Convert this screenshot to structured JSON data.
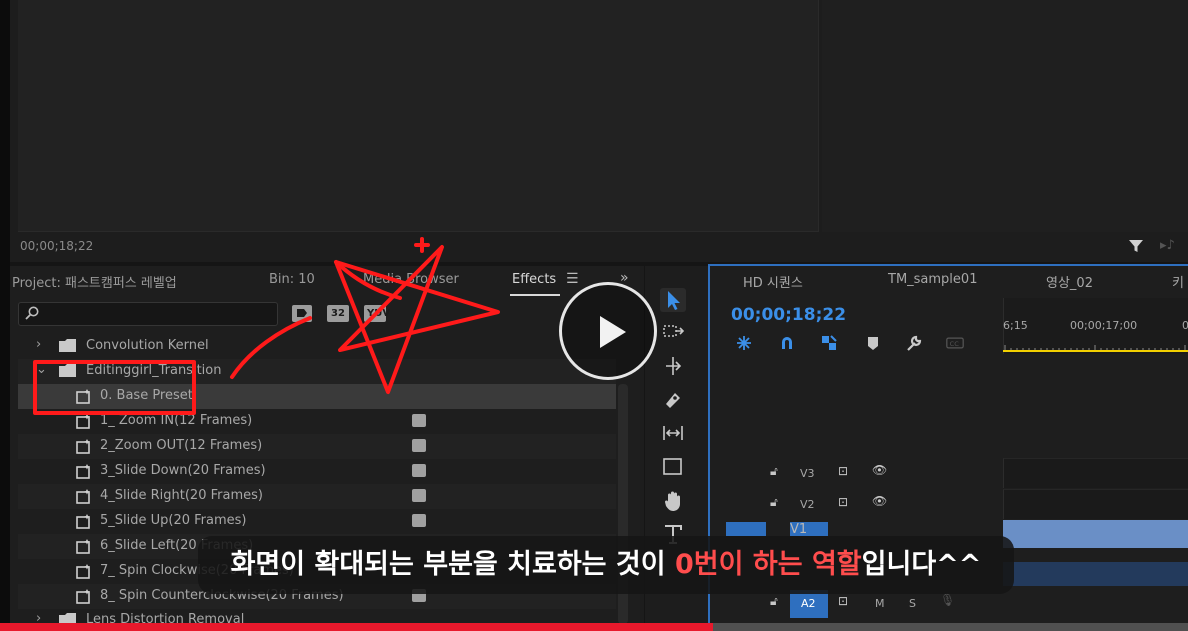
{
  "program_monitor": {
    "timecode": "00;00;18;22"
  },
  "effects_panel": {
    "tabs": [
      {
        "label": "Project: 패스트캠퍼스 레벨업",
        "active": false
      },
      {
        "label": "Bin: 10",
        "active": false
      },
      {
        "label": "Media Browser",
        "active": false
      },
      {
        "label": "Effects",
        "active": true
      }
    ],
    "menu_icon": "hamburger-icon",
    "overflow_icon": "double-chevron-right-icon",
    "search": {
      "value": "",
      "placeholder": "",
      "icon": "search-icon"
    },
    "filter_buttons": [
      "accelerated-icon",
      "32",
      "YUV"
    ],
    "tree": [
      {
        "label": "Convolution Kernel",
        "type": "folder",
        "expanded": false
      },
      {
        "label": "Editinggirl_Transition",
        "type": "folder",
        "expanded": true
      },
      {
        "label": "0. Base Preset",
        "type": "preset",
        "selected": true
      },
      {
        "label": "1_ Zoom IN(12 Frames)",
        "type": "preset"
      },
      {
        "label": "2_Zoom OUT(12 Frames)",
        "type": "preset"
      },
      {
        "label": "3_Slide Down(20 Frames)",
        "type": "preset"
      },
      {
        "label": "4_Slide Right(20 Frames)",
        "type": "preset"
      },
      {
        "label": "5_Slide Up(20 Frames)",
        "type": "preset"
      },
      {
        "label": "6_Slide Left(20 Frames)",
        "type": "preset"
      },
      {
        "label": "7_ Spin Clockwise(20 Frames)",
        "type": "preset"
      },
      {
        "label": "8_ Spin Counterclockwise(20 Frames)",
        "type": "preset"
      },
      {
        "label": "Lens Distortion Removal",
        "type": "folder",
        "expanded": false
      }
    ]
  },
  "tools": [
    "selection-tool-icon",
    "track-select-forward-icon",
    "ripple-edit-icon",
    "razor-icon",
    "slip-icon",
    "rectangle-icon",
    "hand-icon",
    "type-icon"
  ],
  "timeline": {
    "sequence_tabs": [
      "HD 시퀀스",
      "TM_sample01",
      "영상_02",
      "키"
    ],
    "timecode": "00;00;18;22",
    "toolbar_icons": [
      "nest-icon",
      "snap-icon",
      "linked-selection-icon",
      "marker-icon",
      "wrench-icon",
      "captions-icon"
    ],
    "ruler_labels": [
      "6;15",
      "00;00;17;00",
      "0"
    ],
    "tracks": [
      {
        "name": "V3",
        "kind": "video"
      },
      {
        "name": "V2",
        "kind": "video"
      },
      {
        "name": "V1",
        "kind": "video"
      },
      {
        "name": "A2",
        "kind": "audio",
        "mute": "M",
        "solo": "S"
      }
    ]
  },
  "caption": {
    "before": "화면이 확대되는 부분을 치료하는 것이 ",
    "highlight": "0번이 하는 역할",
    "after": "입니다^^"
  },
  "video_progress": 0.6,
  "colors": {
    "timecode_blue": "#3b8fe8",
    "annotation_red": "#ff1a1a",
    "caption_highlight": "#ff4d4d",
    "progress_red": "#e8192c",
    "playhead_yellow": "#f2d000"
  }
}
